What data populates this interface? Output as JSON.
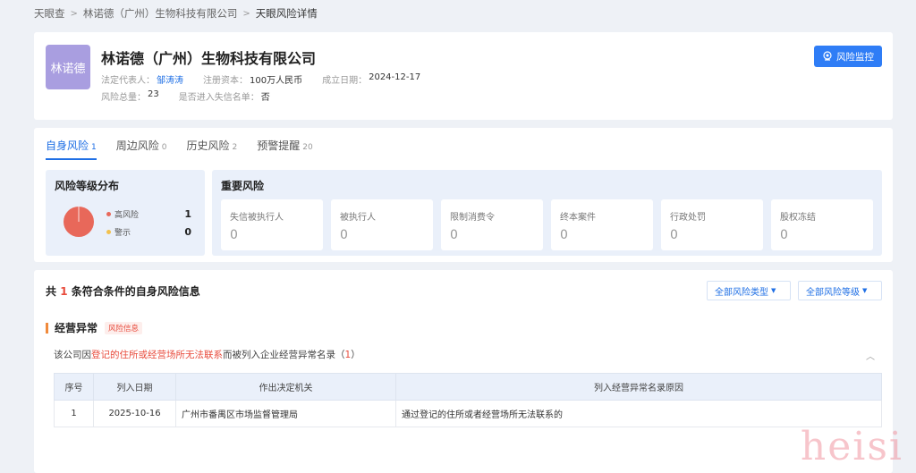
{
  "breadcrumb": [
    "天眼查",
    "林诺德（广州）生物科技有限公司",
    "天眼风险详情"
  ],
  "company": {
    "logo_text": "林诺德",
    "name": "林诺德（广州）生物科技有限公司",
    "legal_rep_label": "法定代表人：",
    "legal_rep": "邹涛涛",
    "capital_label": "注册资本：",
    "capital": "100万人民币",
    "founded_label": "成立日期：",
    "founded": "2024-12-17",
    "risk_total_label": "风险总量：",
    "risk_total": "23",
    "dishonest_label": "是否进入失信名单：",
    "dishonest": "否",
    "monitor_button": "风险监控"
  },
  "tabs": [
    {
      "label": "自身风险",
      "count": "1"
    },
    {
      "label": "周边风险",
      "count": "0"
    },
    {
      "label": "历史风险",
      "count": "2"
    },
    {
      "label": "预警提醒",
      "count": "20"
    }
  ],
  "distribution": {
    "title": "风险等级分布",
    "items": [
      {
        "label": "高风险",
        "value": "1",
        "color": "#e8685a"
      },
      {
        "label": "警示",
        "value": "0",
        "color": "#f2c14e"
      }
    ]
  },
  "important": {
    "title": "重要风险",
    "items": [
      {
        "label": "失信被执行人",
        "value": "0"
      },
      {
        "label": "被执行人",
        "value": "0"
      },
      {
        "label": "限制消费令",
        "value": "0"
      },
      {
        "label": "终本案件",
        "value": "0"
      },
      {
        "label": "行政处罚",
        "value": "0"
      },
      {
        "label": "股权冻结",
        "value": "0"
      }
    ]
  },
  "list": {
    "head_prefix": "共 ",
    "head_count": "1",
    "head_suffix": " 条符合条件的自身风险信息",
    "filter_type": "全部风险类型",
    "filter_level": "全部风险等级",
    "section_title": "经营异常",
    "section_badge": "风险信息",
    "desc_prefix": "该公司因",
    "desc_highlight": "登记的住所或经营场所无法联系",
    "desc_suffix": "而被列入企业经营异常名录（",
    "desc_count": "1",
    "desc_end": "）",
    "columns": [
      "序号",
      "列入日期",
      "作出决定机关",
      "列入经营异常名录原因"
    ],
    "rows": [
      [
        "1",
        "2025-10-16",
        "广州市番禺区市场监督管理局",
        "通过登记的住所或者经营场所无法联系的"
      ]
    ]
  },
  "watermark": "heisi"
}
